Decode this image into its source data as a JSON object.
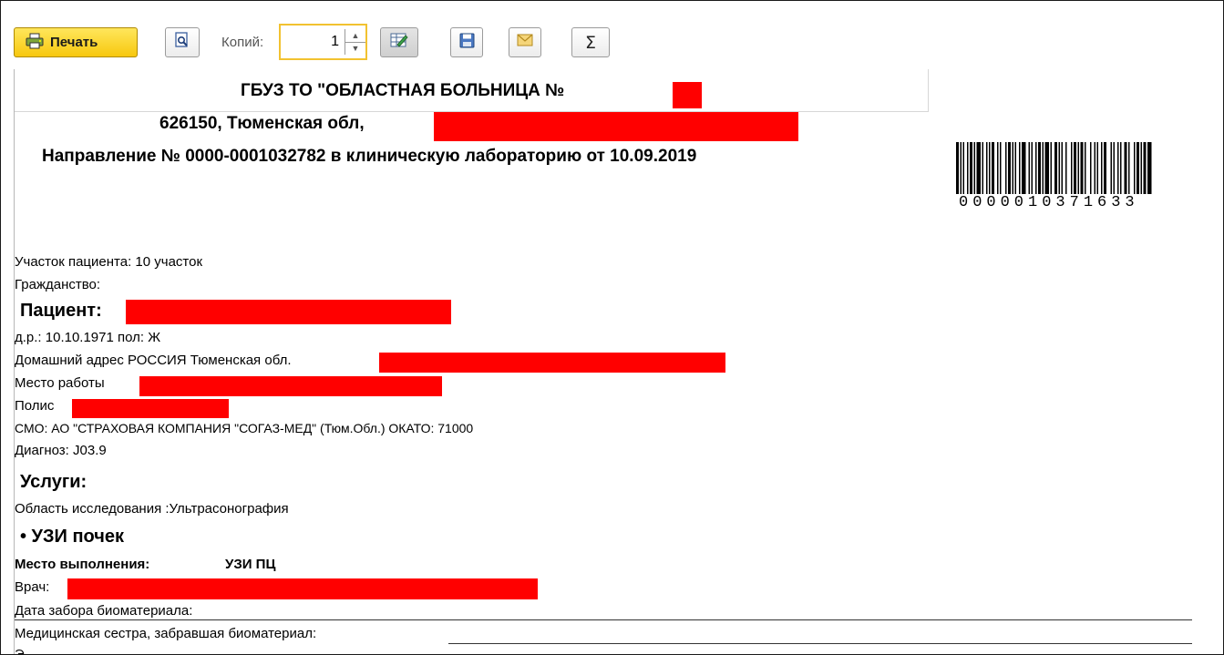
{
  "toolbar": {
    "print_label": "Печать",
    "copies_label": "Копий:",
    "copies_value": "1",
    "sum_symbol": "Σ"
  },
  "document": {
    "org_prefix": "ГБУЗ ТО \"ОБЛАСТНАЯ БОЛЬНИЦА №",
    "address_prefix": "626150, Тюменская обл,",
    "direction_title": "Направление № 0000-0001032782 в клиническую лабораторию от 10.09.2019",
    "barcode_number": "0000010371633",
    "district": "Участок пациента: 10 участок",
    "citizenship": "Гражданство:",
    "patient_label": "Пациент:",
    "birth_sex": "д.р.: 10.10.1971 пол: Ж",
    "home_address_prefix": "Домашний адрес РОССИЯ Тюменская обл.",
    "workplace_label": "Место работы",
    "policy_label": "Полис",
    "smo": "СМО: АО \"СТРАХОВАЯ КОМПАНИЯ \"СОГАЗ-МЕД\" (Тюм.Обл.) ОКАТО: 71000",
    "diagnosis": "Диагноз: J03.9",
    "services_label": "Услуги:",
    "research_area": "Область исследования :Ультрасонография",
    "service_name": "• УЗИ почек",
    "place_label": "Место выполнения:",
    "place_value": "УЗИ ПЦ",
    "doctor_label": "Врач:",
    "biomaterial_date_label": "Дата забора биоматериала:",
    "nurse_label": "Медицинская сестра, забравшая биоматериал:",
    "cut_char": "Э"
  },
  "colors": {
    "redaction": "#ff0000",
    "print_button": "#f7c80e",
    "copies_focus": "#f2c230"
  }
}
